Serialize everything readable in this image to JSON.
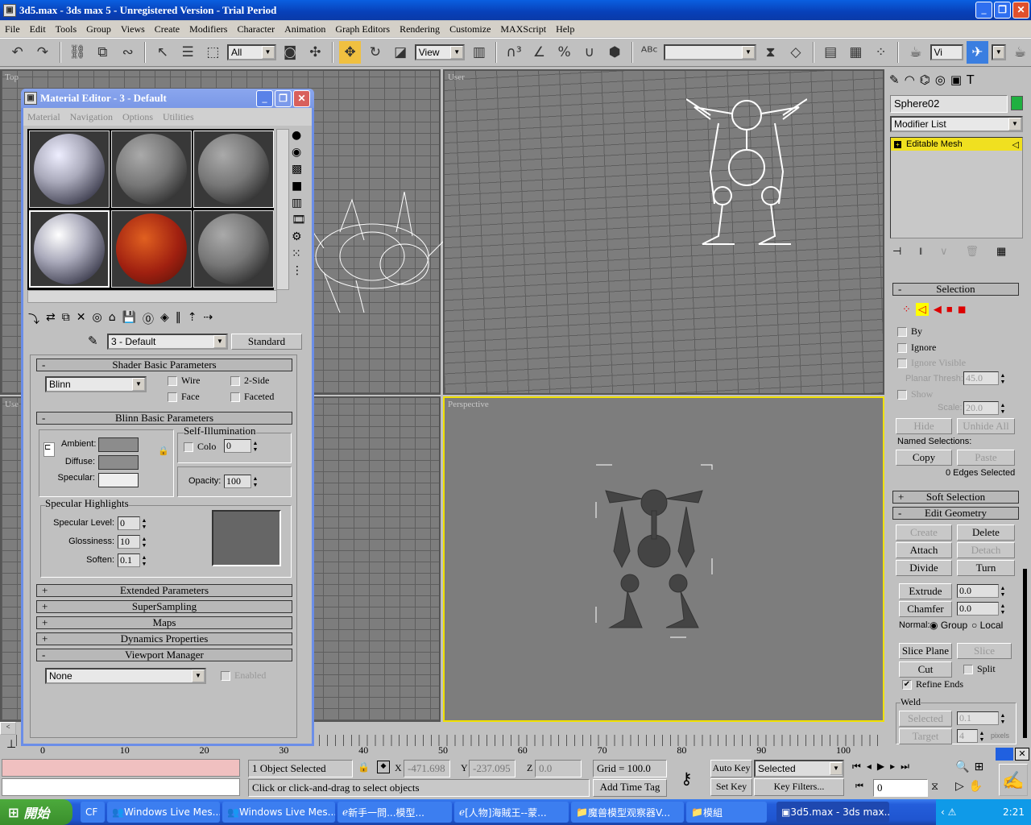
{
  "window": {
    "title": "3d5.max - 3ds max 5 - Unregistered Version - Trial Period"
  },
  "menu": [
    "File",
    "Edit",
    "Tools",
    "Group",
    "Views",
    "Create",
    "Modifiers",
    "Character",
    "Animation",
    "Graph Editors",
    "Rendering",
    "Customize",
    "MAXScript",
    "Help"
  ],
  "toolbar": {
    "selection_filter": "All",
    "ref_coord": "View",
    "named_selection": "",
    "right_combo": "Vi"
  },
  "viewports": {
    "top_left": "Top",
    "top_right": "User",
    "bottom_left": "Use",
    "bottom_right": "Perspective"
  },
  "material_editor": {
    "title": "Material Editor - 3 - Default",
    "menu": [
      "Material",
      "Navigation",
      "Options",
      "Utilities"
    ],
    "material_name": "3 - Default",
    "material_type": "Standard",
    "shader_rollout": "Shader Basic Parameters",
    "shader": "Blinn",
    "wire": "Wire",
    "two_side": "2-Side",
    "face": "Face",
    "faceted": "Faceted",
    "blinn_rollout": "Blinn Basic Parameters",
    "ambient": "Ambient:",
    "diffuse": "Diffuse:",
    "specular": "Specular:",
    "self_illum": "Self-Illumination",
    "color": "Colo",
    "color_value": "0",
    "opacity_label": "Opacity:",
    "opacity": "100",
    "spec_highlights": "Specular Highlights",
    "spec_level_label": "Specular Level:",
    "spec_level": "0",
    "gloss_label": "Glossiness:",
    "gloss": "10",
    "soften_label": "Soften:",
    "soften": "0.1",
    "rollouts": [
      "Extended Parameters",
      "SuperSampling",
      "Maps",
      "Dynamics Properties"
    ],
    "viewport_manager": "Viewport Manager",
    "vm_select": "None",
    "enabled": "Enabled"
  },
  "command_panel": {
    "object_name": "Sphere02",
    "object_color": "#1fb040",
    "modifier_list": "Modifier List",
    "stack_item": "Editable Mesh",
    "selection": {
      "title": "Selection",
      "by": "By",
      "ignore": "Ignore",
      "ignore_visible": "Ignore Visible",
      "planar_label": "Planar Thresh:",
      "planar": "45.0",
      "show": "Show",
      "scale_label": "Scale:",
      "scale": "20.0",
      "hide": "Hide",
      "unhide": "Unhide All",
      "named": "Named Selections:",
      "copy": "Copy",
      "paste": "Paste",
      "count": "0 Edges Selected"
    },
    "soft_selection": "Soft Selection",
    "edit_geometry": {
      "title": "Edit Geometry",
      "create": "Create",
      "delete": "Delete",
      "attach": "Attach",
      "detach": "Detach",
      "divide": "Divide",
      "turn": "Turn",
      "extrude": "Extrude",
      "extrude_val": "0.0",
      "chamfer": "Chamfer",
      "chamfer_val": "0.0",
      "normal": "Normal:",
      "group": "Group",
      "local": "Local",
      "slice_plane": "Slice Plane",
      "slice": "Slice",
      "cut": "Cut",
      "split": "Split",
      "refine": "Refine Ends",
      "weld": "Weld",
      "selected": "Selected",
      "selected_val": "0.1",
      "target": "Target",
      "target_val": "4",
      "pixels": "pixels"
    }
  },
  "timeline": {
    "ticks": [
      "0",
      "10",
      "20",
      "30",
      "40",
      "50",
      "60",
      "70",
      "80",
      "90",
      "100"
    ]
  },
  "status": {
    "objects": "1 Object Selected",
    "x_label": "X",
    "x": "-471.698",
    "y_label": "Y",
    "y": "-237.095",
    "z_label": "Z",
    "z": "0.0",
    "grid": "Grid = 100.0",
    "prompt": "Click or click-and-drag to select objects",
    "add_time_tag": "Add Time Tag",
    "auto_key": "Auto Key",
    "set_key": "Set Key",
    "key_mode": "Selected",
    "key_filters": "Key Filters...",
    "frame": "0"
  },
  "taskbar": {
    "start": "開始",
    "items": [
      "CF",
      "Windows Live Mes...",
      "Windows Live Mes...",
      "新手一問...模型...",
      "[人物]海賊王--蒙...",
      "魔兽模型观察器V...",
      "模組",
      "3d5.max - 3ds max..."
    ],
    "clock": "2:21"
  }
}
